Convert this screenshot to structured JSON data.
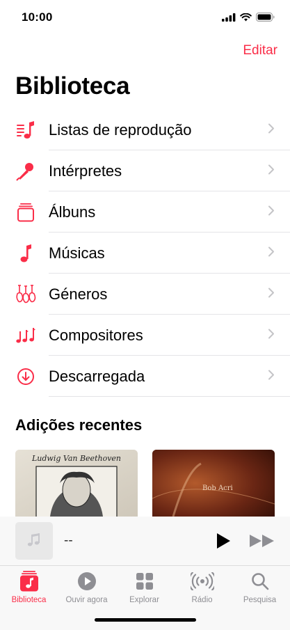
{
  "status": {
    "time": "10:00"
  },
  "header": {
    "edit_label": "Editar",
    "title": "Biblioteca"
  },
  "menu": [
    {
      "label": "Listas de reprodução",
      "icon": "playlist-icon"
    },
    {
      "label": "Intérpretes",
      "icon": "microphone-icon"
    },
    {
      "label": "Álbuns",
      "icon": "album-stack-icon"
    },
    {
      "label": "Músicas",
      "icon": "music-note-icon"
    },
    {
      "label": "Géneros",
      "icon": "guitars-icon"
    },
    {
      "label": "Compositores",
      "icon": "notes-icon"
    },
    {
      "label": "Descarregada",
      "icon": "download-icon"
    }
  ],
  "recent": {
    "title": "Adições recentes",
    "albums": [
      {
        "cover_text": "Ludwig Van Beethoven"
      },
      {
        "cover_text": "Bob Acri"
      }
    ]
  },
  "player": {
    "now_playing": "--"
  },
  "tabs": [
    {
      "label": "Biblioteca",
      "active": true
    },
    {
      "label": "Ouvir agora",
      "active": false
    },
    {
      "label": "Explorar",
      "active": false
    },
    {
      "label": "Rádio",
      "active": false
    },
    {
      "label": "Pesquisa",
      "active": false
    }
  ],
  "colors": {
    "accent": "#fa2d48",
    "icon_gray": "#8e8e93",
    "chevron": "#c4c4c7"
  }
}
